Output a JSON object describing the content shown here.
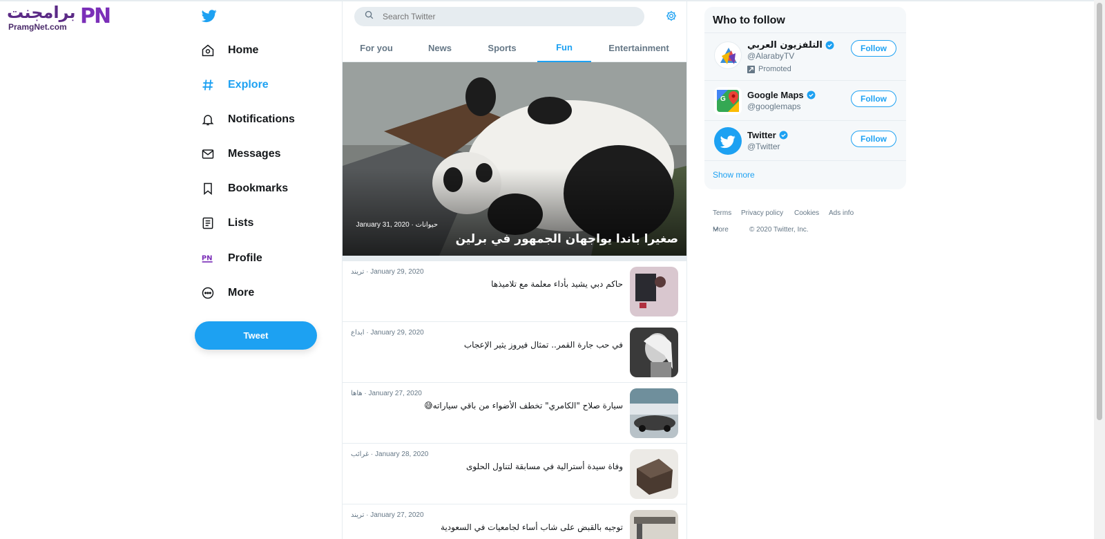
{
  "watermark": {
    "arabic": "برامجنت",
    "latin": "PramgNet.com",
    "mark": "PN"
  },
  "nav": {
    "items": [
      {
        "label": "Home",
        "icon": "home-icon"
      },
      {
        "label": "Explore",
        "icon": "hash-icon",
        "active": true
      },
      {
        "label": "Notifications",
        "icon": "bell-icon"
      },
      {
        "label": "Messages",
        "icon": "envelope-icon"
      },
      {
        "label": "Bookmarks",
        "icon": "bookmark-icon"
      },
      {
        "label": "Lists",
        "icon": "list-icon"
      },
      {
        "label": "Profile",
        "icon": "profile-avatar-icon"
      },
      {
        "label": "More",
        "icon": "more-icon"
      }
    ],
    "tweet_label": "Tweet"
  },
  "search": {
    "placeholder": "Search Twitter"
  },
  "tabs": [
    "For you",
    "News",
    "Sports",
    "Fun",
    "Entertainment"
  ],
  "active_tab": "Fun",
  "hero": {
    "title": "صغيرا باندا يواجهان الجمهور في برلين",
    "date": "January 31, 2020",
    "category": "حيوانات"
  },
  "stories": [
    {
      "category": "تريند",
      "date": "January 29, 2020",
      "title": "حاكم دبي يشيد بأداء معلمة مع تلاميذها"
    },
    {
      "category": "ابداع",
      "date": "January 29, 2020",
      "title": "في حب جارة القمر.. تمثال فيروز يثير الإعجاب"
    },
    {
      "category": "هاها",
      "date": "January 27, 2020",
      "title": "سيارة صلاح \"الكامري\" تخطف الأضواء من باقي سياراته😅"
    },
    {
      "category": "غرائب",
      "date": "January 28, 2020",
      "title": "وفاة سيدة أسترالية في مسابقة لتناول الحلوى"
    },
    {
      "category": "تريند",
      "date": "January 27, 2020",
      "title": "توجيه بالقبض على شاب أساء لجامعيات في السعودية"
    }
  ],
  "who_to_follow": {
    "title": "Who to follow",
    "accounts": [
      {
        "name": "التلفزيون العربي",
        "handle": "@AlarabyTV",
        "promoted": "Promoted",
        "follow": "Follow"
      },
      {
        "name": "Google Maps",
        "handle": "@googlemaps",
        "follow": "Follow"
      },
      {
        "name": "Twitter",
        "handle": "@Twitter",
        "follow": "Follow"
      }
    ],
    "show_more": "Show more"
  },
  "footer": {
    "links": [
      "Terms",
      "Privacy policy",
      "Cookies",
      "Ads info"
    ],
    "more": "More",
    "copyright": "© 2020 Twitter, Inc."
  },
  "colors": {
    "accent": "#1da1f2",
    "text": "#14171a",
    "muted": "#657786",
    "border": "#e6ecf0"
  }
}
